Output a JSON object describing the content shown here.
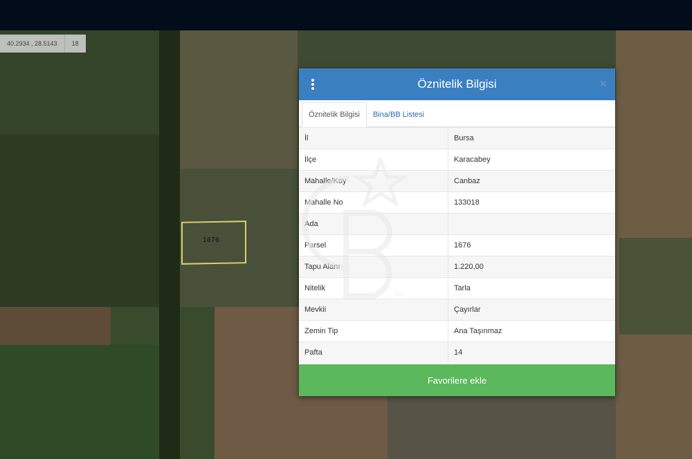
{
  "coords": {
    "lat_lon": "40.2934 , 28.5143",
    "zoom": "18"
  },
  "map": {
    "parcel_label": "1676"
  },
  "modal": {
    "title": "Öznitelik Bilgisi",
    "tabs": [
      {
        "label": "Öznitelik Bilgisi"
      },
      {
        "label": "Bina/BB Listesi"
      }
    ],
    "rows": [
      {
        "key": "İl",
        "value": "Bursa"
      },
      {
        "key": "İlçe",
        "value": "Karacabey"
      },
      {
        "key": "Mahalle/Koy",
        "value": "Canbaz"
      },
      {
        "key": "Mahalle No",
        "value": "133018"
      },
      {
        "key": "Ada",
        "value": ""
      },
      {
        "key": "Parsel",
        "value": "1676"
      },
      {
        "key": "Tapu Alanı",
        "value": "1.220,00"
      },
      {
        "key": "Nitelik",
        "value": "Tarla"
      },
      {
        "key": "Mevkii",
        "value": "Çayırlar"
      },
      {
        "key": "Zemin Tip",
        "value": "Ana Taşınmaz"
      },
      {
        "key": "Pafta",
        "value": "14"
      }
    ],
    "favorite_button": "Favorilere ekle"
  },
  "watermark": {
    "mark": "SM"
  }
}
